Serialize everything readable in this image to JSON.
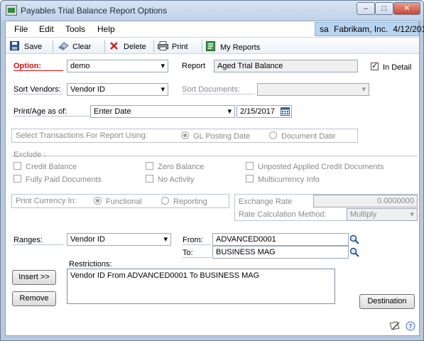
{
  "window": {
    "title": "Payables Trial Balance Report Options",
    "min_label": "–",
    "max_label": "□",
    "close_label": "✕"
  },
  "menu": {
    "items": [
      "File",
      "Edit",
      "Tools",
      "Help"
    ]
  },
  "user_bar": {
    "user": "sa",
    "company": "Fabrikam, Inc.",
    "date": "4/12/2017"
  },
  "toolbar": {
    "save": "Save",
    "clear": "Clear",
    "delete": "Delete",
    "print": "Print",
    "my_reports": "My Reports"
  },
  "option": {
    "label": "Option:",
    "value": "demo"
  },
  "report": {
    "label": "Report",
    "value": "Aged Trial Balance"
  },
  "in_detail": {
    "label": "In Detail",
    "checked": true
  },
  "sort_vendors": {
    "label": "Sort Vendors:",
    "value": "Vendor ID"
  },
  "sort_documents": {
    "label": "Sort Documents:",
    "value": ""
  },
  "print_age": {
    "label": "Print/Age as of:",
    "value": "Enter Date",
    "date": "2/15/2017"
  },
  "transactions": {
    "label": "Select Transactions For Report Using:",
    "options": [
      "GL Posting Date",
      "Document Date"
    ],
    "selected": "GL Posting Date"
  },
  "exclude": {
    "label": "Exclude :",
    "items": [
      "Credit Balance",
      "Zero Balance",
      "Unposted Applied Credit Documents",
      "Fully Paid Documents",
      "No Activity",
      "Multicurrency Info"
    ]
  },
  "currency": {
    "label": "Print Currency In:",
    "options": [
      "Functional",
      "Reporting"
    ],
    "selected": "Functional"
  },
  "exchange_rate": {
    "label": "Exchange Rate",
    "value": "0.0000000"
  },
  "rate_method": {
    "label": "Rate Calculation Method:",
    "value": "Multiply"
  },
  "ranges": {
    "label": "Ranges:",
    "value": "Vendor ID",
    "from_label": "From:",
    "from": "ADVANCED0001",
    "to_label": "To:",
    "to": "BUSINESS MAG"
  },
  "restrictions": {
    "label": "Restrictions:",
    "items": [
      "Vendor ID From ADVANCED0001 To BUSINESS MAG"
    ]
  },
  "buttons": {
    "insert": "Insert >>",
    "remove": "Remove",
    "destination": "Destination"
  },
  "colors": {
    "required_label": "#d01010",
    "title_bar": "#c7d8ee",
    "company_bar": "#b9d4ee"
  }
}
